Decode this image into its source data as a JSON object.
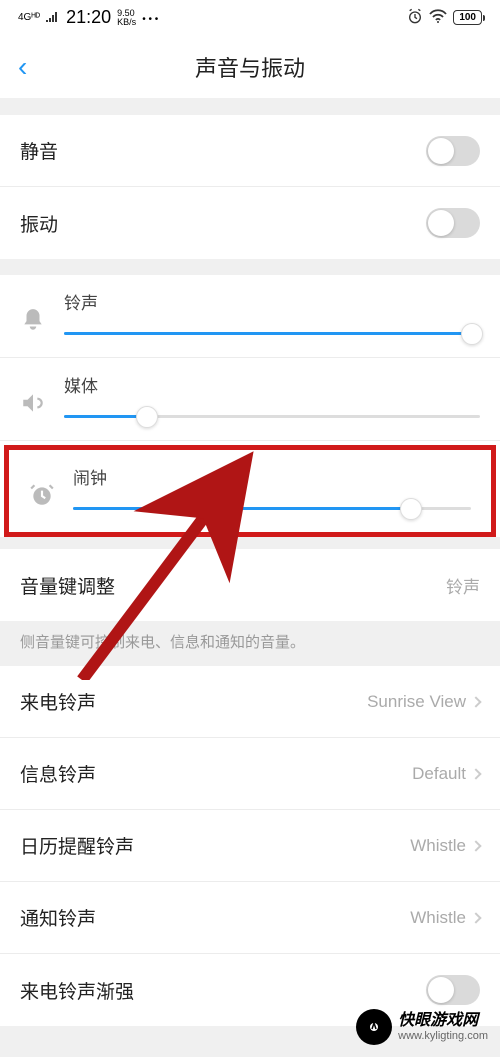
{
  "status": {
    "network": "4Gᴴᴰ",
    "time": "21:20",
    "speed_top": "9.50",
    "speed_unit": "KB/s",
    "battery": "100"
  },
  "header": {
    "back": "‹",
    "title": "声音与振动"
  },
  "toggles": {
    "mute": "静音",
    "vibrate": "振动"
  },
  "sliders": {
    "ring": {
      "label": "铃声",
      "percent": 98
    },
    "media": {
      "label": "媒体",
      "percent": 20
    },
    "alarm": {
      "label": "闹钟",
      "percent": 85
    }
  },
  "volume_key": {
    "label": "音量键调整",
    "value": "铃声",
    "hint": "侧音量键可控制来电、信息和通知的音量。"
  },
  "ringtones": {
    "call": {
      "label": "来电铃声",
      "value": "Sunrise View"
    },
    "message": {
      "label": "信息铃声",
      "value": "Default"
    },
    "calendar": {
      "label": "日历提醒铃声",
      "value": "Whistle"
    },
    "notification": {
      "label": "通知铃声",
      "value": "Whistle"
    },
    "ascending": "来电铃声渐强"
  },
  "watermark": {
    "title": "快眼游戏网",
    "sub": "www.kyligting.com"
  }
}
